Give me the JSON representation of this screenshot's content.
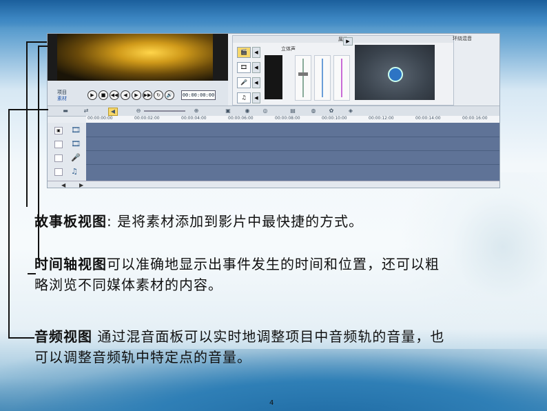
{
  "screenshot": {
    "preview": {
      "mode_labels": [
        "项目",
        "素材"
      ],
      "timecode": "00:00:00:00",
      "controls": [
        "▶",
        "■",
        "◀◀",
        "◀",
        "▶",
        "▶▶",
        "↻",
        "🔊"
      ]
    },
    "mixer": {
      "header": "属性",
      "stereo_label": "立体声",
      "surround_label": "环绕混音",
      "track_buttons": [
        "🎬",
        "🎞",
        "🎤",
        "♫"
      ]
    },
    "timeline": {
      "ruler_ticks": [
        "00:00:00:00",
        "00:00:02:00",
        "00:00:04:00",
        "00:00:06:00",
        "00:00:08:00",
        "00:00:10:00",
        "00:00:12:00",
        "00:00:14:00",
        "00:00:16:00"
      ],
      "track_icons": [
        "🎞",
        "🎞",
        "🎤",
        "♫"
      ]
    }
  },
  "text": {
    "p1_bold": "故事板视图",
    "p1_rest": ": 是将素材添加到影片中最快捷的方式。",
    "p2_bold": "时间轴视图",
    "p2_line1": "可以准确地显示出事件发生的时间和位置，还可以粗",
    "p2_line2": "略浏览不同媒体素材的内容。",
    "p3_bold": "音频视图",
    "p3_line1": " 通过混音面板可以实时地调整项目中音频轨的音量，也",
    "p3_line2": "可以调整音频轨中特定点的音量。"
  },
  "page_number": "4"
}
